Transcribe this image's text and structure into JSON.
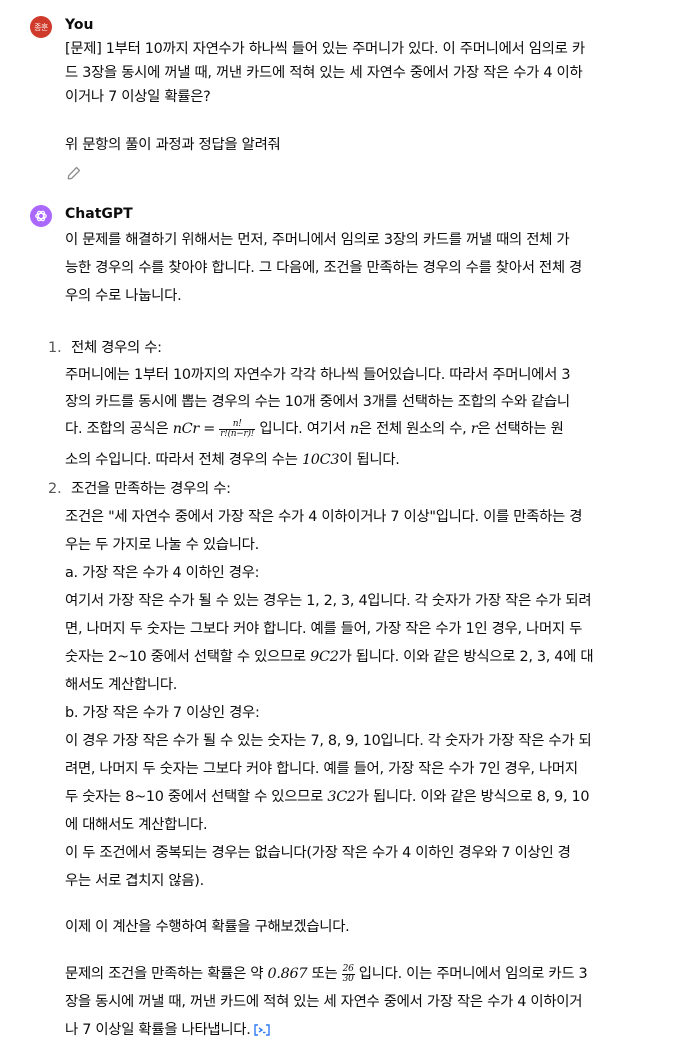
{
  "user": {
    "avatar_text": "종훈",
    "name": "You",
    "lines": [
      "[문제] 1부터 10까지 자연수가 하나씩 들어 있는 주머니가 있다. 이 주머니에서 임의로 카",
      "드 3장을 동시에 꺼낼 때, 꺼낸 카드에 적혀 있는 세 자연수 중에서 가장 작은 수가 4 이하",
      "이거나 7 이상일 확률은?",
      "위 문항의 풀이 과정과 정답을 알려줘"
    ]
  },
  "assistant": {
    "name": "ChatGPT",
    "intro": [
      "이 문제를 해결하기 위해서는 먼저, 주머니에서 임의로 3장의 카드를 꺼낼 때의 전체 가",
      "능한 경우의 수를 찾아야 합니다. 그 다음에, 조건을 만족하는 경우의 수를 찾아서 전체 경",
      "우의 수로 나눕니다."
    ],
    "item1": {
      "num": "1.",
      "title": "전체 경우의 수:",
      "l1": "주머니에는 1부터 10까지의 자연수가 각각 하나씩 들어있습니다. 따라서 주머니에서 3",
      "l2": "장의 카드를 동시에 뽑는 경우의 수는 10개 중에서 3개를 선택하는 조합의 수와 같습니",
      "l3_a": "다. 조합의 공식은 ",
      "l3_m1": "nCr = ",
      "l3_fn": "n!",
      "l3_fd": "r!(n−r)!",
      "l3_b": " 입니다. 여기서 ",
      "l3_m2": "n",
      "l3_c": "은 전체 원소의 수, ",
      "l3_m3": "r",
      "l3_d": "은 선택하는 원",
      "l4_a": "소의 수입니다. 따라서 전체 경우의 수는 ",
      "l4_m": "10C3",
      "l4_b": "이 됩니다."
    },
    "item2": {
      "num": "2.",
      "title": "조건을 만족하는 경우의 수:",
      "l1": "조건은 \"세 자연수 중에서 가장 작은 수가 4 이하이거나 7 이상\"입니다. 이를 만족하는 경",
      "l2": "우는 두 가지로 나눌 수 있습니다.",
      "a_title": "a. 가장 작은 수가 4 이하인 경우:",
      "a1": "여기서 가장 작은 수가 될 수 있는 경우는 1, 2, 3, 4입니다. 각 숫자가 가장 작은 수가 되려",
      "a2": "면, 나머지 두 숫자는 그보다 커야 합니다. 예를 들어, 가장 작은 수가 1인 경우, 나머지 두",
      "a3_a": "숫자는 2~10 중에서 선택할 수 있으므로 ",
      "a3_m": "9C2",
      "a3_b": "가 됩니다. 이와 같은 방식으로 2, 3, 4에 대",
      "a4": "해서도 계산합니다.",
      "b_title": "b. 가장 작은 수가 7 이상인 경우:",
      "b1": "이 경우 가장 작은 수가 될 수 있는 숫자는 7, 8, 9, 10입니다. 각 숫자가 가장 작은 수가 되",
      "b2": "려면, 나머지 두 숫자는 그보다 커야 합니다. 예를 들어, 가장 작은 수가 7인 경우, 나머지",
      "b3_a": "두 숫자는 8~10 중에서 선택할 수 있으므로 ",
      "b3_m": "3C2",
      "b3_b": "가 됩니다. 이와 같은 방식으로 8, 9, 10",
      "b4": "에 대해서도 계산합니다.",
      "c1": "이 두 조건에서 중복되는 경우는 없습니다(가장 작은 수가 4 이하인 경우와 7 이상인 경",
      "c2": "우는 서로 겹치지 않음)."
    },
    "calc": "이제 이 계산을 수행하여 확률을 구해보겠습니다.",
    "final": {
      "l1_a": "문제의 조건을 만족하는 확률은 약 ",
      "l1_m": "0.867",
      "l1_b": " 또는 ",
      "l1_fn": "26",
      "l1_fd": "30",
      "l1_c": " 입니다. 이는 주머니에서 임의로 카드 3",
      "l2": "장을 동시에 꺼낼 때, 꺼낸 카드에 적혀 있는 세 자연수 중에서 가장 작은 수가 4 이하이거",
      "l3": "나 7 이상일 확률을 나타냅니다."
    }
  },
  "colors": {
    "user_avatar": "#cf3a2a",
    "gpt_avatar": "#ab68ff",
    "text": "#0d0d0d",
    "muted": "#555555"
  },
  "icons": {
    "edit": "pencil-icon",
    "gpt": "openai-logo-icon",
    "analysis": "code-analysis-icon"
  }
}
